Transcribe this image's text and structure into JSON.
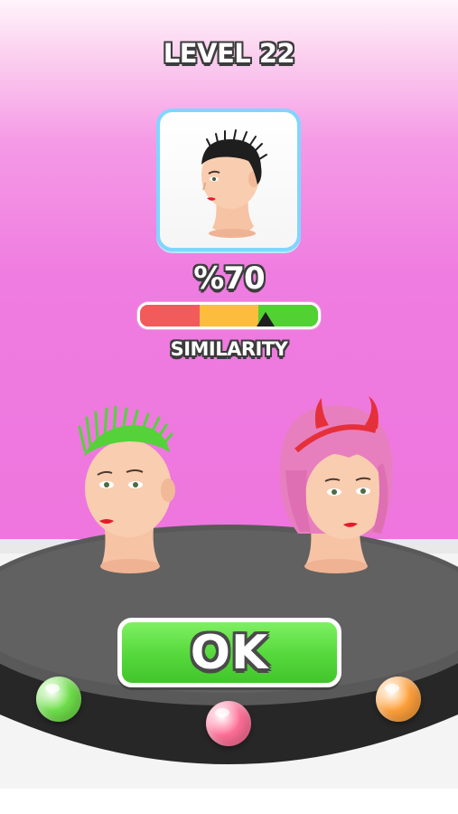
{
  "header": {
    "level_title": "LEVEL 22"
  },
  "target": {
    "icon": "target-hairstyle-reference"
  },
  "score": {
    "percent_text": "%70",
    "similarity": 0.7,
    "meter_label": "SIMILARITY",
    "segment_colors": [
      "#f25b5b",
      "#fcbd3f",
      "#52d133"
    ]
  },
  "action": {
    "ok_label": "OK",
    "color": "#55d83b"
  },
  "dye_knobs": [
    {
      "name": "green-dye-knob",
      "color": "#6fe04a"
    },
    {
      "name": "pink-dye-knob",
      "color": "#ff6f97"
    },
    {
      "name": "orange-dye-knob",
      "color": "#ffa03a"
    }
  ]
}
